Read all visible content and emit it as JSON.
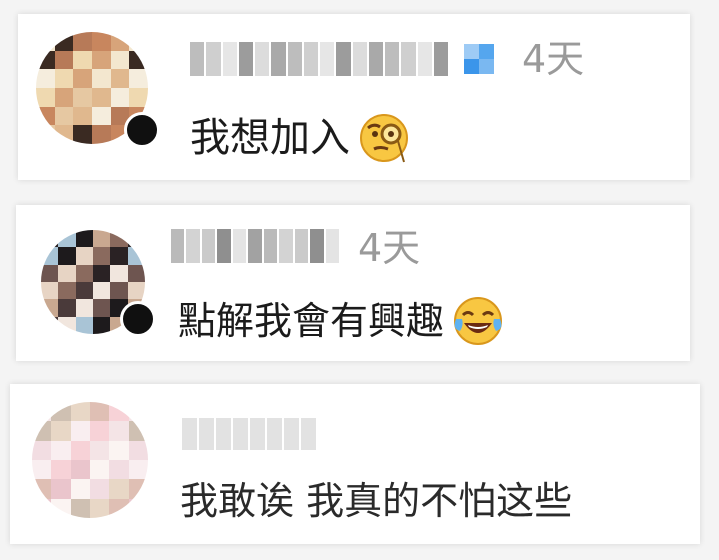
{
  "comments": [
    {
      "time": "4天",
      "text": "我想加入",
      "emoji": "face-with-monocle-icon"
    },
    {
      "time": "4天",
      "text": "點解我會有興趣",
      "emoji": "face-with-tears-of-joy-icon"
    },
    {
      "time": "",
      "text": "我敢诶 我真的不怕这些",
      "emoji": ""
    }
  ],
  "colors": {
    "time_text": "#9a9a9a",
    "comment_text": "#1b1b1b",
    "card_bg": "#ffffff",
    "page_bg": "#f4f4f4"
  }
}
